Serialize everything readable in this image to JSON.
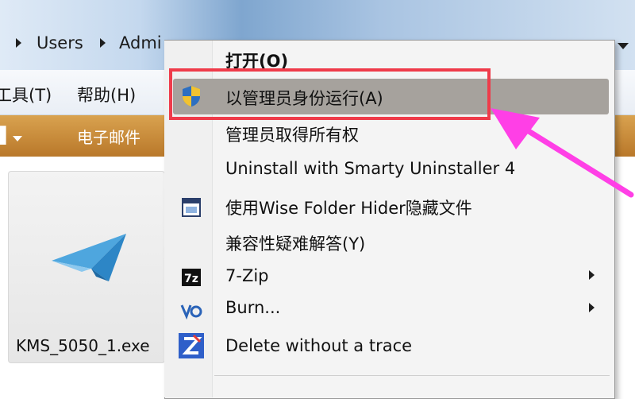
{
  "address_bar": {
    "crumbs": [
      "Users",
      "Admi"
    ]
  },
  "menubar": {
    "items": [
      "工具(T)",
      "帮助(H)"
    ]
  },
  "command_bar": {
    "email": "电子邮件"
  },
  "file": {
    "name": "KMS_5050_1.exe"
  },
  "context_menu": {
    "open": "打开(O)",
    "run_as_admin": "以管理员身份运行(A)",
    "take_ownership": "管理员取得所有权",
    "smarty": "Uninstall with Smarty Uninstaller 4",
    "wise": "使用Wise Folder Hider隐藏文件",
    "compat": "兼容性疑难解答(Y)",
    "sevenzip": "7-Zip",
    "burn": "Burn...",
    "delete": "Delete without a trace"
  },
  "icons": {
    "shield": "uac-shield-icon",
    "wise": "wise-folder-hider-icon",
    "sevenzip": "7zip-icon",
    "burn": "burn-icon",
    "delete": "delete-without-trace-icon"
  },
  "colors": {
    "highlight_box": "#ef3b4a",
    "arrow": "#ff3fe6",
    "command_bar": "#c98d3a"
  }
}
